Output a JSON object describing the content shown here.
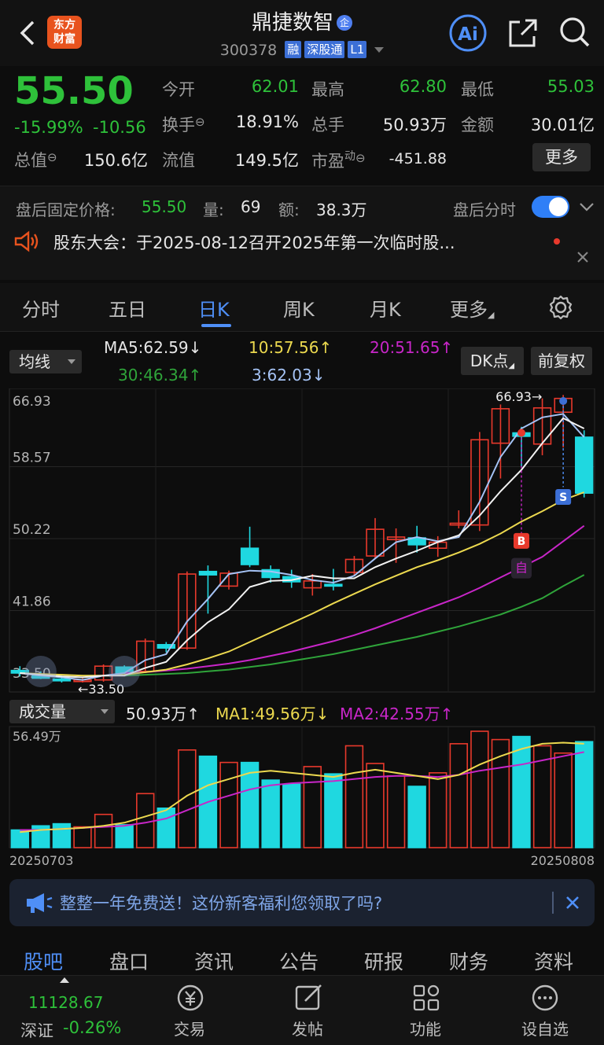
{
  "header": {
    "logo_line1": "东方",
    "logo_line2": "财富",
    "stock_name": "鼎捷数智",
    "qi_badge": "企",
    "code": "300378",
    "tags": [
      "融",
      "深股通",
      "L1"
    ],
    "ai_label": "Ai"
  },
  "quote": {
    "price": "55.50",
    "change_pct": "-15.99%",
    "change_amt": "-10.56",
    "open_label": "今开",
    "open": "62.01",
    "high_label": "最高",
    "high": "62.80",
    "low_label": "最低",
    "low": "55.03",
    "turnover_label": "换手",
    "turnover": "18.91%",
    "volume_label": "总手",
    "volume": "50.93万",
    "amount_label": "金额",
    "amount": "30.01亿",
    "total_cap_label": "总值",
    "total_cap": "150.6亿",
    "float_cap_label": "流值",
    "float_cap": "149.5亿",
    "pe_label": "市盈",
    "pe_sup": "动",
    "pe": "-451.88",
    "more_label": "更多"
  },
  "after_hours": {
    "fixed_price_label": "盘后固定价格:",
    "fixed_price": "55.50",
    "vol_label": "量:",
    "vol": "69",
    "amt_label": "额:",
    "amt": "38.3万",
    "toggle_label": "盘后分时",
    "toggle_on": true,
    "notice": "股东大会：于2025-08-12召开2025年第一次临时股..."
  },
  "tabs": [
    "分时",
    "五日",
    "日K",
    "周K",
    "月K",
    "更多"
  ],
  "active_tab": "日K",
  "indicators": {
    "ma_selector": "均线",
    "ma5": "MA5:62.59↓",
    "ma10": "10:57.56↑",
    "ma20": "20:51.65↑",
    "ma30": "30:46.34↑",
    "ma3": "3:62.03↓",
    "dk_button": "DK点",
    "adjust_button": "前复权",
    "volume_selector": "成交量",
    "vol_now": "50.93万↑",
    "vol_ma1": "MA1:49.56万↓",
    "vol_ma2": "MA2:42.55万↑"
  },
  "chart_data": {
    "type": "candlestick",
    "y_ticks": [
      "66.93",
      "58.57",
      "50.22",
      "41.86",
      "33.50"
    ],
    "ylim": [
      33.5,
      66.93
    ],
    "max_label": "66.93→",
    "min_label": "←33.50",
    "x_start": "20250703",
    "x_end": "20250808",
    "vol_max_label": "56.49万",
    "markers": {
      "buy": "B",
      "sell": "S",
      "self": "自"
    },
    "candles": [
      {
        "o": 34.9,
        "h": 35.4,
        "l": 34.2,
        "c": 34.6
      },
      {
        "o": 34.4,
        "h": 34.8,
        "l": 33.9,
        "c": 34.0
      },
      {
        "o": 33.9,
        "h": 34.3,
        "l": 33.5,
        "c": 33.7
      },
      {
        "o": 33.7,
        "h": 34.0,
        "l": 33.5,
        "c": 33.8
      },
      {
        "o": 33.8,
        "h": 35.6,
        "l": 33.6,
        "c": 35.4
      },
      {
        "o": 35.3,
        "h": 35.5,
        "l": 34.5,
        "c": 34.6
      },
      {
        "o": 34.8,
        "h": 38.6,
        "l": 34.6,
        "c": 38.3
      },
      {
        "o": 37.9,
        "h": 38.2,
        "l": 37.0,
        "c": 37.5
      },
      {
        "o": 37.5,
        "h": 46.4,
        "l": 37.3,
        "c": 46.1
      },
      {
        "o": 46.4,
        "h": 47.1,
        "l": 41.5,
        "c": 46.0
      },
      {
        "o": 44.7,
        "h": 46.5,
        "l": 44.3,
        "c": 46.2
      },
      {
        "o": 49.1,
        "h": 51.6,
        "l": 46.9,
        "c": 47.2
      },
      {
        "o": 46.6,
        "h": 47.1,
        "l": 45.1,
        "c": 45.7
      },
      {
        "o": 45.8,
        "h": 46.6,
        "l": 44.5,
        "c": 45.2
      },
      {
        "o": 44.5,
        "h": 46.1,
        "l": 43.6,
        "c": 45.3
      },
      {
        "o": 44.9,
        "h": 46.7,
        "l": 44.2,
        "c": 44.7
      },
      {
        "o": 46.3,
        "h": 48.2,
        "l": 45.9,
        "c": 47.8
      },
      {
        "o": 48.2,
        "h": 52.6,
        "l": 47.9,
        "c": 51.3
      },
      {
        "o": 50.1,
        "h": 51.4,
        "l": 47.4,
        "c": 50.4
      },
      {
        "o": 50.3,
        "h": 51.7,
        "l": 48.6,
        "c": 49.5
      },
      {
        "o": 49.1,
        "h": 50.5,
        "l": 48.1,
        "c": 49.8
      },
      {
        "o": 51.8,
        "h": 53.5,
        "l": 51.4,
        "c": 52.0
      },
      {
        "o": 51.8,
        "h": 62.6,
        "l": 51.1,
        "c": 61.7
      },
      {
        "o": 61.3,
        "h": 65.8,
        "l": 57.2,
        "c": 65.3
      },
      {
        "o": 62.5,
        "h": 63.2,
        "l": 58.6,
        "c": 62.1
      },
      {
        "o": 61.2,
        "h": 66.5,
        "l": 59.9,
        "c": 65.4
      },
      {
        "o": 64.9,
        "h": 66.9,
        "l": 60.8,
        "c": 66.5
      },
      {
        "o": 62.0,
        "h": 62.8,
        "l": 55.0,
        "c": 55.5
      }
    ],
    "volumes": [
      17,
      21,
      23,
      20,
      32,
      22,
      52,
      38,
      94,
      88,
      82,
      82,
      65,
      61,
      78,
      71,
      98,
      81,
      69,
      59,
      72,
      100,
      112,
      104,
      107,
      98,
      91,
      102
    ],
    "series": {
      "ma5": [
        34.6,
        34.4,
        34.2,
        34.1,
        34.3,
        34.3,
        35.2,
        35.9,
        38.4,
        40.5,
        42.0,
        44.6,
        45.3,
        45.4,
        45.9,
        45.6,
        45.6,
        46.9,
        47.9,
        48.8,
        49.8,
        50.6,
        52.9,
        55.7,
        58.2,
        61.3,
        64.2,
        63.0
      ],
      "ma3": [
        34.6,
        34.3,
        34.1,
        33.8,
        34.3,
        34.6,
        36.1,
        36.8,
        40.6,
        43.2,
        46.1,
        46.5,
        46.4,
        46.0,
        45.4,
        45.1,
        45.9,
        47.9,
        49.8,
        50.4,
        49.9,
        50.4,
        54.5,
        59.7,
        63.0,
        64.3,
        64.7,
        62.0
      ],
      "ma10": [
        34.6,
        34.5,
        34.4,
        34.3,
        34.3,
        34.4,
        34.7,
        35.0,
        35.6,
        36.3,
        37.1,
        38.2,
        39.3,
        40.4,
        41.5,
        42.7,
        43.8,
        44.9,
        45.9,
        46.9,
        47.7,
        48.6,
        49.6,
        50.8,
        52.2,
        53.4,
        54.7,
        55.6
      ],
      "ma20": [
        null,
        null,
        null,
        null,
        null,
        34.6,
        34.7,
        34.9,
        35.1,
        35.4,
        35.7,
        36.1,
        36.6,
        37.1,
        37.7,
        38.3,
        39.0,
        39.8,
        40.7,
        41.6,
        42.5,
        43.4,
        44.5,
        45.7,
        46.9,
        48.1,
        49.9,
        51.7
      ],
      "ma30": [
        null,
        null,
        null,
        null,
        null,
        34.3,
        34.4,
        34.5,
        34.6,
        34.8,
        35.0,
        35.3,
        35.6,
        36.0,
        36.4,
        36.8,
        37.3,
        37.8,
        38.3,
        38.8,
        39.4,
        40.0,
        40.7,
        41.4,
        42.3,
        43.3,
        44.7,
        46.0
      ],
      "vol_ma1": [
        15,
        17,
        18,
        19,
        21,
        24,
        30,
        36,
        50,
        60,
        66,
        72,
        74,
        72,
        70,
        68,
        72,
        75,
        72,
        69,
        66,
        70,
        80,
        88,
        95,
        100,
        101,
        100
      ],
      "vol_ma2": [
        17,
        17,
        18,
        19,
        20,
        21,
        24,
        28,
        36,
        44,
        50,
        56,
        60,
        62,
        63,
        64,
        66,
        68,
        69,
        69,
        68,
        70,
        74,
        77,
        80,
        84,
        88,
        92
      ]
    },
    "colors": {
      "up": "#e8392c",
      "down": "#1fd8e0",
      "ma5": "#f2f2f2",
      "ma3": "#a5c3f5",
      "ma10": "#ecd94f",
      "ma20": "#c826c8",
      "ma30": "#2fa43a",
      "vol_ma1": "#ecd94f",
      "vol_ma2": "#c826c8"
    }
  },
  "ad": {
    "text": "整整一年免费送！这份新客福利您领取了吗?"
  },
  "bottom_tabs": [
    "股吧",
    "盘口",
    "资讯",
    "公告",
    "研报",
    "财务",
    "资料"
  ],
  "active_bottom_tab": "股吧",
  "toolbar": {
    "index_value": "11128.67",
    "index_name": "深证",
    "index_change": "-0.26%",
    "items": [
      "交易",
      "发帖",
      "功能",
      "设自选"
    ]
  }
}
